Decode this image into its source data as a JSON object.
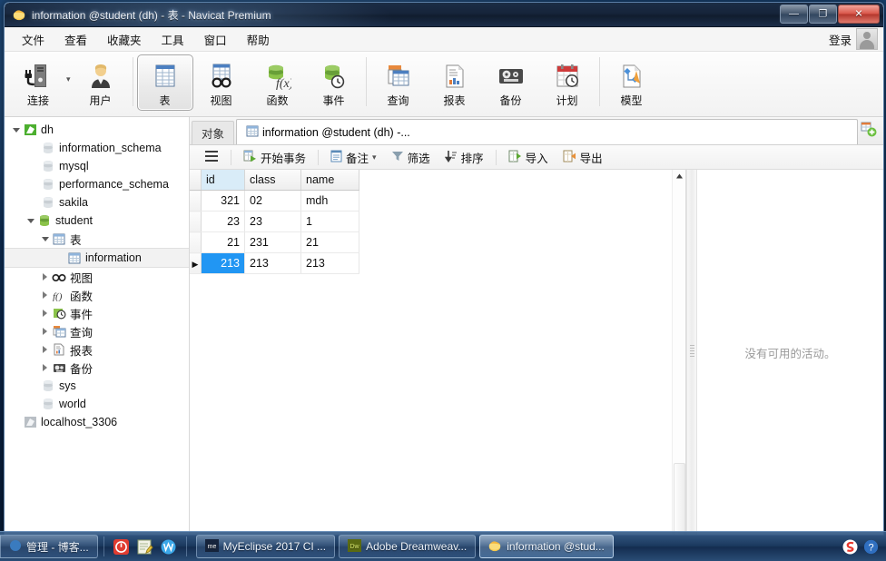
{
  "window": {
    "title": "information @student (dh) - 表 - Navicat Premium",
    "app_icon": "navicat-icon",
    "minimize_glyph": "—",
    "maximize_glyph": "❐",
    "close_glyph": "✕"
  },
  "menu": {
    "items": [
      {
        "label": "文件",
        "name": "menu-file"
      },
      {
        "label": "查看",
        "name": "menu-view"
      },
      {
        "label": "收藏夹",
        "name": "menu-favorites"
      },
      {
        "label": "工具",
        "name": "menu-tools"
      },
      {
        "label": "窗口",
        "name": "menu-window"
      },
      {
        "label": "帮助",
        "name": "menu-help"
      }
    ],
    "login_label": "登录"
  },
  "toolbar": {
    "buttons": [
      {
        "label": "连接",
        "icon": "connection-icon",
        "selected": false,
        "has_dropdown": true
      },
      {
        "label": "用户",
        "icon": "user-icon",
        "selected": false
      },
      {
        "label": "表",
        "icon": "table-icon",
        "selected": true
      },
      {
        "label": "视图",
        "icon": "view-icon",
        "selected": false
      },
      {
        "label": "函数",
        "icon": "function-icon",
        "selected": false
      },
      {
        "label": "事件",
        "icon": "event-icon",
        "selected": false
      },
      {
        "label": "查询",
        "icon": "query-icon",
        "selected": false
      },
      {
        "label": "报表",
        "icon": "report-icon",
        "selected": false
      },
      {
        "label": "备份",
        "icon": "backup-icon",
        "selected": false
      },
      {
        "label": "计划",
        "icon": "schedule-icon",
        "selected": false
      },
      {
        "label": "模型",
        "icon": "model-icon",
        "selected": false
      }
    ],
    "dropdown_glyph": "▾"
  },
  "sidebar": {
    "items": [
      {
        "label": "dh",
        "icon": "connection-icon",
        "indent": 0,
        "twisty": "open",
        "selected": false
      },
      {
        "label": "information_schema",
        "icon": "database-grey-icon",
        "indent": 1,
        "twisty": "",
        "selected": false
      },
      {
        "label": "mysql",
        "icon": "database-grey-icon",
        "indent": 1,
        "twisty": "",
        "selected": false
      },
      {
        "label": "performance_schema",
        "icon": "database-grey-icon",
        "indent": 1,
        "twisty": "",
        "selected": false
      },
      {
        "label": "sakila",
        "icon": "database-grey-icon",
        "indent": 1,
        "twisty": "",
        "selected": false
      },
      {
        "label": "student",
        "icon": "database-green-icon",
        "indent": 1,
        "twisty": "open",
        "selected": false
      },
      {
        "label": "表",
        "icon": "table-icon",
        "indent": 2,
        "twisty": "open",
        "selected": false
      },
      {
        "label": "information",
        "icon": "table-icon",
        "indent": 3,
        "twisty": "",
        "selected": true
      },
      {
        "label": "视图",
        "icon": "view-icon",
        "indent": 2,
        "twisty": "closed",
        "selected": false
      },
      {
        "label": "函数",
        "icon": "function-icon",
        "indent": 2,
        "twisty": "closed",
        "selected": false
      },
      {
        "label": "事件",
        "icon": "event-icon",
        "indent": 2,
        "twisty": "closed",
        "selected": false
      },
      {
        "label": "查询",
        "icon": "query-icon",
        "indent": 2,
        "twisty": "closed",
        "selected": false
      },
      {
        "label": "报表",
        "icon": "report-icon",
        "indent": 2,
        "twisty": "closed",
        "selected": false
      },
      {
        "label": "备份",
        "icon": "backup-icon",
        "indent": 2,
        "twisty": "closed",
        "selected": false
      },
      {
        "label": "sys",
        "icon": "database-grey-icon",
        "indent": 1,
        "twisty": "",
        "selected": false
      },
      {
        "label": "world",
        "icon": "database-grey-icon",
        "indent": 1,
        "twisty": "",
        "selected": false
      },
      {
        "label": "localhost_3306",
        "icon": "connection-grey-icon",
        "indent": 0,
        "twisty": "",
        "selected": false
      }
    ]
  },
  "tabs": {
    "object_tab": "对象",
    "active_tab": "information @student (dh) -...",
    "active_tab_icon": "table-icon",
    "new_tab_icon": "new-tab-icon"
  },
  "gridbar": {
    "menu_icon": "hamburger-icon",
    "buttons": [
      {
        "label": "开始事务",
        "icon": "begin-transaction-icon"
      },
      {
        "label": "备注",
        "icon": "note-icon",
        "dropdown": "▾"
      },
      {
        "label": "筛选",
        "icon": "filter-icon"
      },
      {
        "label": "排序",
        "icon": "sort-icon"
      },
      {
        "label": "导入",
        "icon": "import-icon"
      },
      {
        "label": "导出",
        "icon": "export-icon"
      }
    ]
  },
  "grid": {
    "columns": [
      "id",
      "class",
      "name"
    ],
    "rows": [
      {
        "id": "321",
        "class": "02",
        "name": "mdh",
        "selected": false
      },
      {
        "id": "23",
        "class": "23",
        "name": "1",
        "selected": false
      },
      {
        "id": "21",
        "class": "231",
        "name": "21",
        "selected": false
      },
      {
        "id": "213",
        "class": "213",
        "name": "213",
        "selected": true
      }
    ],
    "row_arrow": "▶",
    "scroll_up_glyph": "▲",
    "selection_color": "#2196f3",
    "header_highlight_color": "#d9ecf8"
  },
  "activity": {
    "empty_message": "没有可用的活动。"
  },
  "taskbar": {
    "items": [
      {
        "label": "管理 - 博客...",
        "icon": "browser-icon",
        "active": false,
        "first": true
      },
      {
        "label": "MyEclipse 2017 CI ...",
        "icon": "myeclipse-icon",
        "active": false
      },
      {
        "label": "Adobe Dreamweav...",
        "icon": "dreamweaver-icon",
        "active": false
      },
      {
        "label": "information @stud...",
        "icon": "navicat-icon",
        "active": true
      }
    ],
    "quick_launch": [
      {
        "name": "media-player-icon"
      },
      {
        "name": "notepad-icon"
      },
      {
        "name": "word-icon"
      }
    ],
    "tray": [
      {
        "name": "sogou-icon"
      },
      {
        "name": "help-icon"
      }
    ]
  }
}
